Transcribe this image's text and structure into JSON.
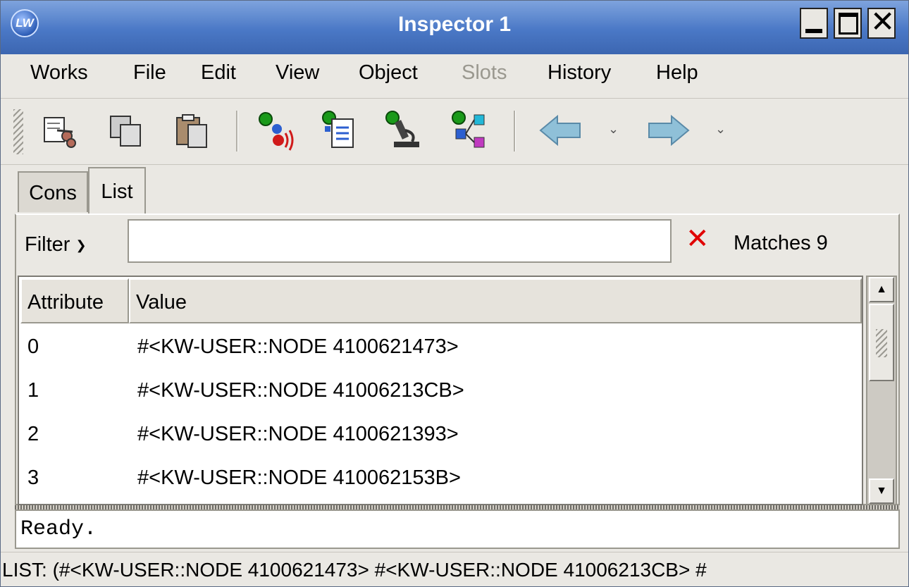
{
  "window": {
    "title": "Inspector 1",
    "app_icon_text": "LW"
  },
  "menubar": {
    "items": [
      {
        "label": "Works",
        "enabled": true
      },
      {
        "label": "File",
        "enabled": true
      },
      {
        "label": "Edit",
        "enabled": true
      },
      {
        "label": "View",
        "enabled": true
      },
      {
        "label": "Object",
        "enabled": true
      },
      {
        "label": "Slots",
        "enabled": false
      },
      {
        "label": "History",
        "enabled": true
      },
      {
        "label": "Help",
        "enabled": true
      }
    ]
  },
  "toolbar": {
    "buttons": [
      "cut-icon",
      "copy-icon",
      "paste-icon",
      "object-sound-icon",
      "object-list-icon",
      "object-inspect-icon",
      "object-tree-icon",
      "back-arrow-icon",
      "forward-arrow-icon"
    ]
  },
  "tabs": [
    {
      "label": "Cons",
      "active": false
    },
    {
      "label": "List",
      "active": true
    }
  ],
  "filter": {
    "label": "Filter",
    "value": "",
    "matches_text": "Matches 9"
  },
  "table": {
    "columns": [
      "Attribute",
      "Value"
    ],
    "rows": [
      {
        "attribute": "0",
        "value": "#<KW-USER::NODE 4100621473>"
      },
      {
        "attribute": "1",
        "value": "#<KW-USER::NODE 41006213CB>"
      },
      {
        "attribute": "2",
        "value": "#<KW-USER::NODE 4100621393>"
      },
      {
        "attribute": "3",
        "value": "#<KW-USER::NODE 410062153B>"
      }
    ]
  },
  "status": {
    "message": "Ready.",
    "list_line": "LIST: (#<KW-USER::NODE 4100621473> #<KW-USER::NODE 41006213CB> #"
  },
  "colors": {
    "titlebar": "#4a78c6",
    "clear_icon": "#e00000",
    "window_bg": "#eae8e3"
  }
}
